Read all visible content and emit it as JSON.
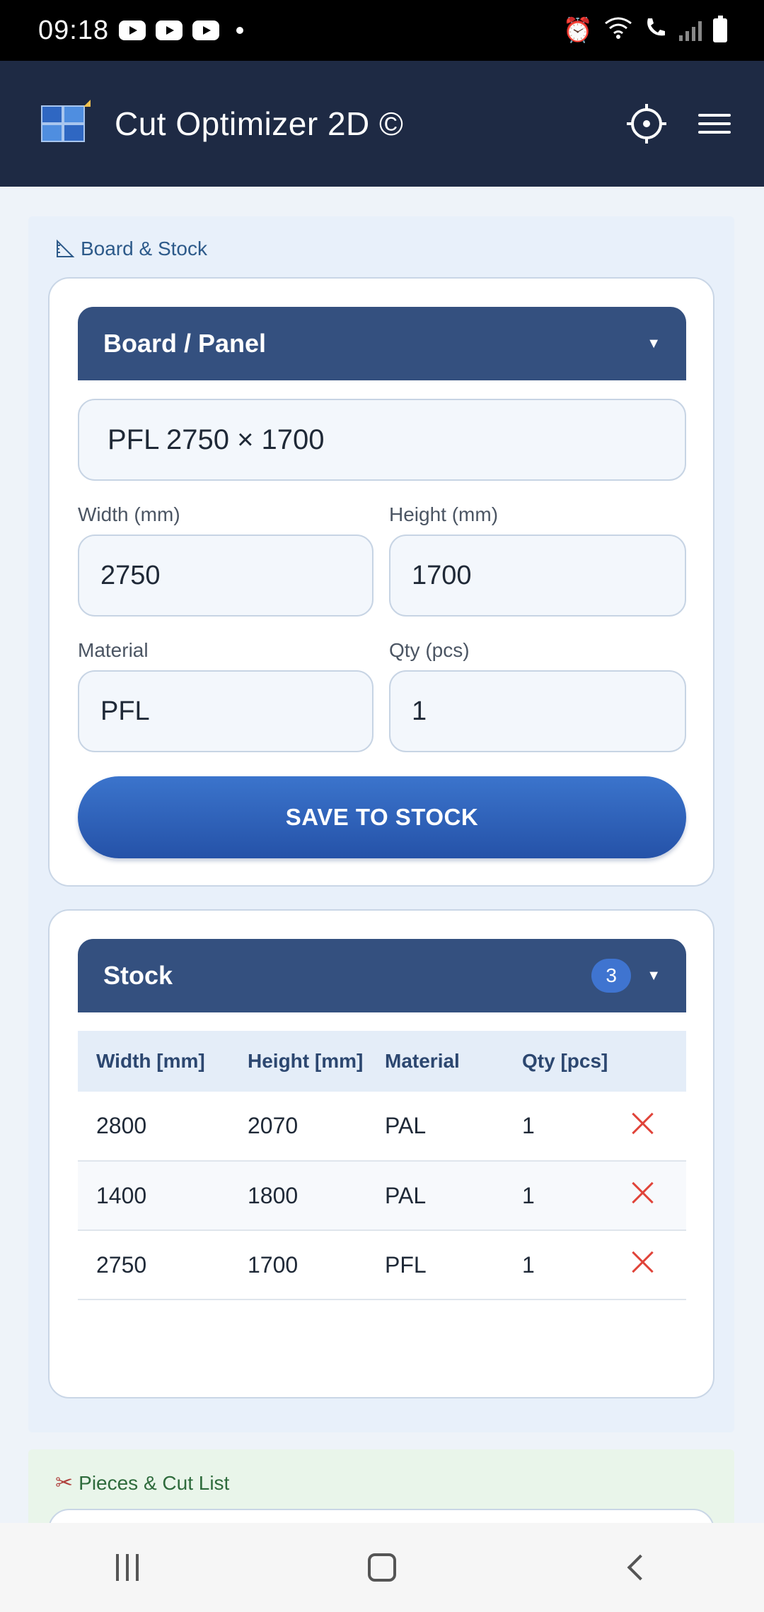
{
  "status_bar": {
    "time": "09:18"
  },
  "header": {
    "title": "Cut Optimizer 2D ©"
  },
  "board_stock": {
    "section_title": "Board & Stock",
    "board_card": {
      "title": "Board / Panel",
      "preset_value": "PFL 2750 × 1700",
      "width_label": "Width (mm)",
      "width_value": "2750",
      "height_label": "Height (mm)",
      "height_value": "1700",
      "material_label": "Material",
      "material_value": "PFL",
      "qty_label": "Qty (pcs)",
      "qty_value": "1",
      "save_label": "SAVE TO STOCK"
    },
    "stock_card": {
      "title": "Stock",
      "count": "3",
      "columns": [
        "Width [mm]",
        "Height [mm]",
        "Material",
        "Qty [pcs]"
      ],
      "rows": [
        [
          "2800",
          "2070",
          "PAL",
          "1"
        ],
        [
          "1400",
          "1800",
          "PAL",
          "1"
        ],
        [
          "2750",
          "1700",
          "PFL",
          "1"
        ]
      ]
    }
  },
  "pieces": {
    "section_title": "Pieces & Cut List"
  },
  "colors": {
    "header_bg": "#1e2a44",
    "card_head_bg": "#34507f",
    "accent": "#3b74cc",
    "delete": "#e0443a"
  }
}
